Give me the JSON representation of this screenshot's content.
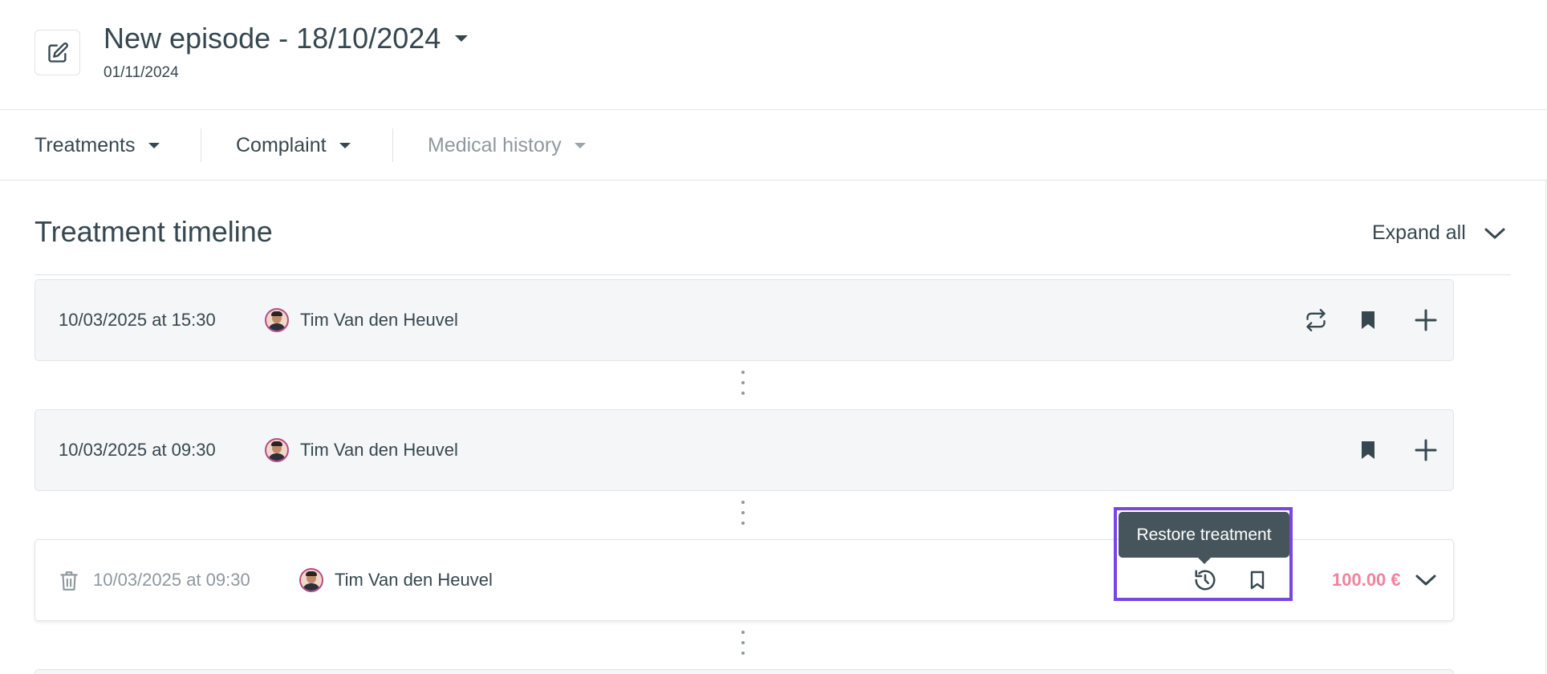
{
  "header": {
    "title": "New episode - 18/10/2024",
    "subtitle": "01/11/2024"
  },
  "tabs": [
    {
      "label": "Treatments",
      "disabled": false
    },
    {
      "label": "Complaint",
      "disabled": false
    },
    {
      "label": "Medical history",
      "disabled": true
    }
  ],
  "section": {
    "title": "Treatment timeline",
    "expand_label": "Expand all"
  },
  "treatments": [
    {
      "datetime": "10/03/2025 at 15:30",
      "practitioner": "Tim Van den Heuvel",
      "actions": [
        "repeat-icon",
        "bookmark-filled-icon",
        "plus-icon"
      ]
    },
    {
      "datetime": "10/03/2025 at 09:30",
      "practitioner": "Tim Van den Heuvel",
      "actions": [
        "bookmark-filled-icon",
        "plus-icon"
      ]
    },
    {
      "datetime": "10/03/2025 at 09:30",
      "practitioner": "Tim Van den Heuvel",
      "deleted": true,
      "price": "100.00 €",
      "actions": [
        "restore-history-icon",
        "bookmark-outline-icon",
        "chevron-down-icon"
      ]
    }
  ],
  "tooltip": {
    "text": "Restore treatment"
  },
  "colors": {
    "text": "#36474f",
    "muted": "#8e989e",
    "price": "#f0839e",
    "highlight": "#7a45e6",
    "tooltip_bg": "#46555c",
    "card_bg": "#f5f6f8"
  }
}
